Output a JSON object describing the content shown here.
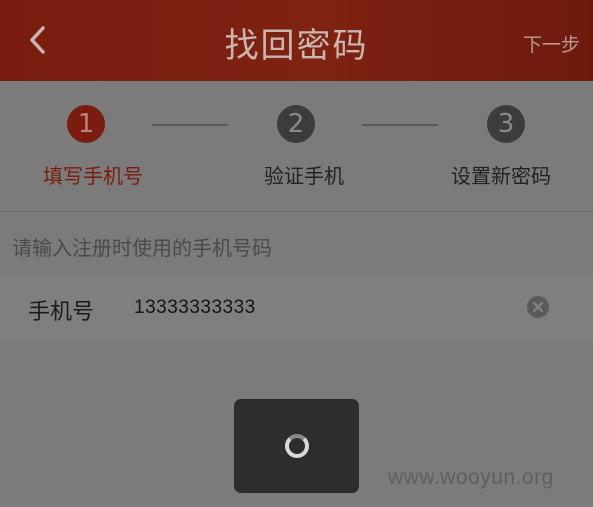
{
  "header": {
    "title": "找回密码",
    "next_label": "下一步",
    "back_icon": "chevron-left-icon",
    "bg_color": "#7a1d10"
  },
  "steps": [
    {
      "number": "1",
      "label": "填写手机号",
      "state": "active"
    },
    {
      "number": "2",
      "label": "验证手机",
      "state": "inactive"
    },
    {
      "number": "3",
      "label": "设置新密码",
      "state": "inactive"
    }
  ],
  "form": {
    "hint": "请输入注册时使用的手机号码",
    "phone_label": "手机号",
    "phone_value": "13333333333",
    "clear_icon": "clear-circle-icon"
  },
  "loading": {
    "icon": "spinner-icon"
  },
  "watermark": "www.wooyun.org",
  "colors": {
    "accent": "#7a1c10",
    "overlay_bg": "#7b7b7b",
    "dialog_bg": "#2d2d2d"
  }
}
